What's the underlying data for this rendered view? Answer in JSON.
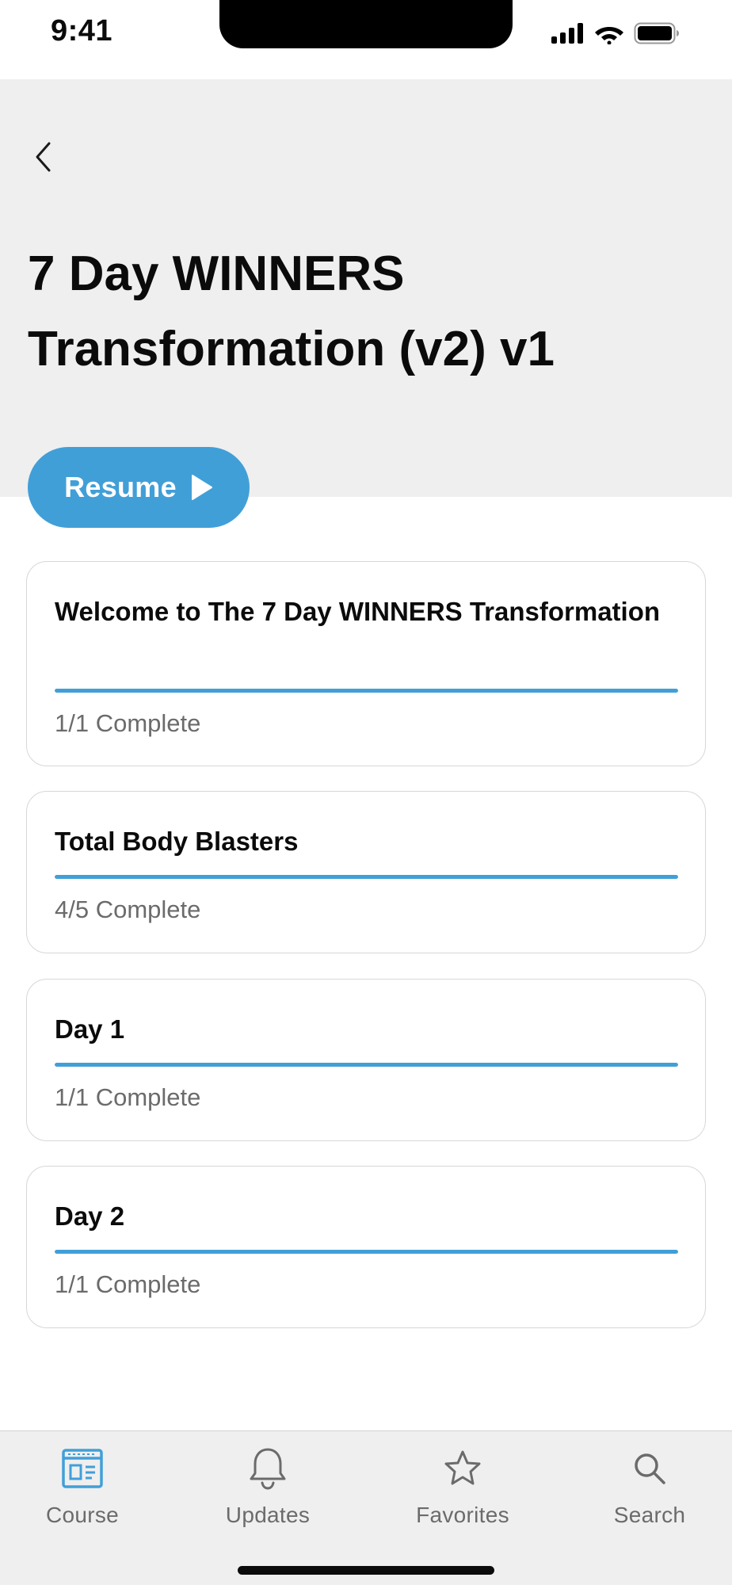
{
  "status_bar": {
    "time": "9:41"
  },
  "header": {
    "title": "7 Day WINNERS Transformation (v2) v1"
  },
  "resume_button": {
    "label": "Resume"
  },
  "modules": [
    {
      "title": "Welcome to The 7 Day WINNERS Transformation",
      "status": "1/1 Complete",
      "progress": 1.0
    },
    {
      "title": "Total Body Blasters",
      "status": "4/5 Complete",
      "progress": 1.0
    },
    {
      "title": "Day 1",
      "status": "1/1 Complete",
      "progress": 1.0
    },
    {
      "title": "Day 2",
      "status": "1/1 Complete",
      "progress": 1.0
    }
  ],
  "tab_bar": {
    "tabs": [
      {
        "label": "Course",
        "icon": "course-icon",
        "active": true
      },
      {
        "label": "Updates",
        "icon": "bell-icon",
        "active": false
      },
      {
        "label": "Favorites",
        "icon": "star-icon",
        "active": false
      },
      {
        "label": "Search",
        "icon": "search-icon",
        "active": false
      }
    ]
  },
  "colors": {
    "accent": "#419fd8",
    "header_bg": "#efefef",
    "muted_text": "#6b6b6b"
  }
}
